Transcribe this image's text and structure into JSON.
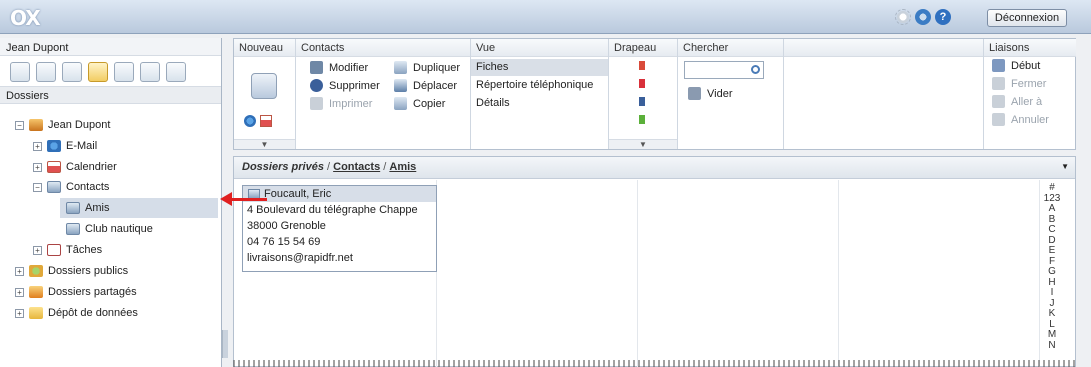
{
  "header": {
    "logo": "OX",
    "logout_label": "Déconnexion",
    "icons": [
      "gear-icon",
      "refresh-icon",
      "help-icon"
    ]
  },
  "sidebar": {
    "user_name": "Jean Dupont",
    "section_label": "Dossiers",
    "tree": [
      {
        "label": "Jean Dupont",
        "icon": "user-icon"
      },
      {
        "label": "E-Mail",
        "icon": "mail-icon"
      },
      {
        "label": "Calendrier",
        "icon": "calendar-icon"
      },
      {
        "label": "Contacts",
        "icon": "contacts-icon"
      },
      {
        "label": "Amis",
        "icon": "contacts-icon"
      },
      {
        "label": "Club nautique",
        "icon": "contacts-icon"
      },
      {
        "label": "Tâches",
        "icon": "tasks-icon"
      },
      {
        "label": "Dossiers publics",
        "icon": "public-folder-icon"
      },
      {
        "label": "Dossiers partagés",
        "icon": "shared-folder-icon"
      },
      {
        "label": "Dépôt de données",
        "icon": "folder-icon"
      }
    ]
  },
  "toolbar": {
    "nouveau": "Nouveau",
    "contacts": "Contacts",
    "modifier": "Modifier",
    "supprimer": "Supprimer",
    "imprimer": "Imprimer",
    "dupliquer": "Dupliquer",
    "deplacer": "Déplacer",
    "copier": "Copier",
    "vue": "Vue",
    "vue_items": [
      "Fiches",
      "Répertoire téléphonique",
      "Détails"
    ],
    "drapeau": "Drapeau",
    "chercher": "Chercher",
    "vider": "Vider",
    "liaisons": "Liaisons",
    "debut": "Début",
    "fermer": "Fermer",
    "aller": "Aller à",
    "annuler": "Annuler"
  },
  "main": {
    "breadcrumb_root": "Dossiers privés",
    "breadcrumb_sep": "/",
    "breadcrumb_contacts": "Contacts",
    "breadcrumb_current": "Amis",
    "contact": {
      "name": "Foucault, Eric",
      "address": "4 Boulevard du télégraphe Chappe",
      "city": "38000 Grenoble",
      "phone": "04 76 15 54 69",
      "email": "livraisons@rapidfr.net"
    },
    "alphabet": [
      "#",
      "123",
      "A",
      "B",
      "C",
      "D",
      "E",
      "F",
      "G",
      "H",
      "I",
      "J",
      "K",
      "L",
      "M",
      "N"
    ]
  }
}
